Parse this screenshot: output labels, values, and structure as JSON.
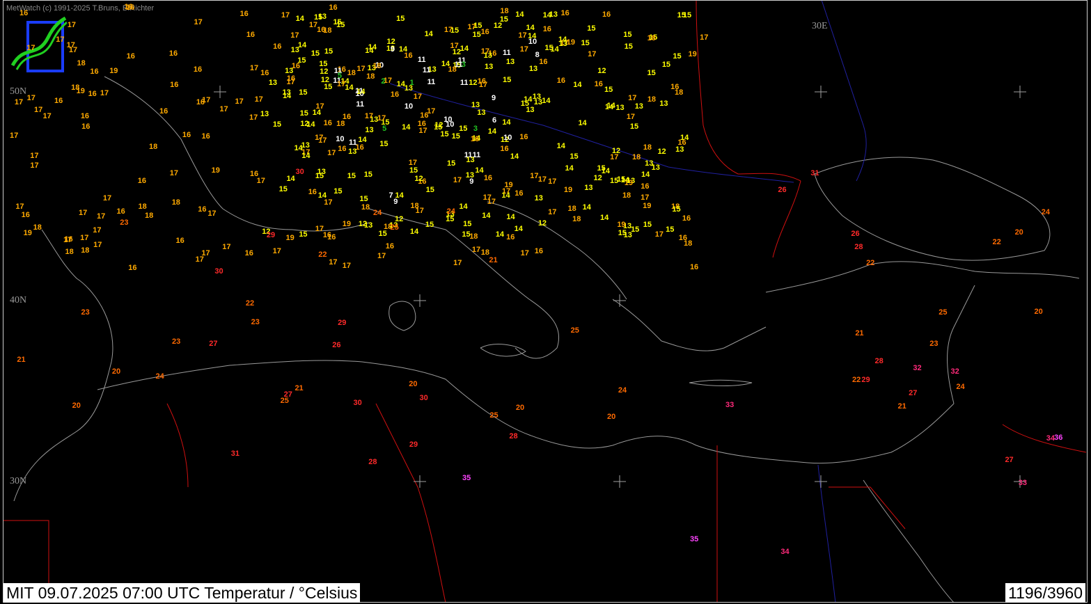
{
  "header": {
    "copyright": "MetWatch  (c) 1991-2025 T.Bruns, B.Richter"
  },
  "grid_labels": {
    "lon_30e": "30E",
    "lat_50n": "50N",
    "lat_40n": "40N",
    "lat_30n": "30N"
  },
  "footer": {
    "caption": "MIT 09.07.2025 07:00 UTC    Temperatur / °Celsius",
    "count": "1196/3960"
  },
  "legend_colors": {
    "le5": "#22c422",
    "6-11": "#ffffff",
    "12-15": "#ffff00",
    "16-19": "#ffaa00",
    "20-25": "#ff6a00",
    "26-31": "#ff2a2a",
    "32-34": "#ff2a7a",
    "35+": "#ff44ff"
  },
  "map_data": {
    "type": "station_temperature_map",
    "unit": "°C",
    "temperatures": [
      [
        "14",
        "16",
        "17",
        "16",
        "16",
        "17",
        "17",
        "17",
        "14",
        "14",
        "15",
        "15",
        "14",
        "15",
        "17",
        "16",
        "16",
        "15",
        "16",
        "16",
        "17",
        "18",
        "16",
        "16",
        "15",
        "17",
        "15",
        "18",
        "17",
        "16",
        "18",
        "17",
        "17",
        "16",
        "16",
        "15",
        "16",
        "15",
        "17",
        "17",
        "15",
        "17",
        "16",
        "17",
        "17",
        "17",
        "16",
        "15",
        "16",
        "17",
        "17",
        "15",
        "17",
        "17",
        "18",
        "15",
        "15",
        "14",
        "18",
        "15",
        "15",
        "15",
        "16",
        "16",
        "17",
        "16",
        "17",
        "17",
        "16",
        "17",
        "17",
        "16",
        "15",
        "16",
        "17",
        "17",
        "14",
        "17",
        "17",
        "16",
        "17",
        "17",
        "16",
        "16",
        "17",
        "17",
        "14",
        "14",
        "14",
        "13",
        "15",
        "14",
        "14",
        "13",
        "13",
        "14",
        "14",
        "15",
        "15",
        "17",
        "18",
        "15",
        "16",
        "17",
        "16",
        "18",
        "17",
        "17",
        "17",
        "17",
        "18",
        "17",
        "18",
        "15",
        "16",
        "14",
        "17",
        "15",
        "16",
        "17",
        "15",
        "16",
        "17",
        "17",
        "16",
        "17",
        "15",
        "15",
        "14",
        "15",
        "17",
        "14",
        "17",
        "14",
        "12",
        "14",
        "15",
        "13",
        "13",
        "13",
        "12",
        "11",
        "15",
        "14",
        "14",
        "14",
        "17",
        "16",
        "16",
        "16",
        "17",
        "13",
        "13",
        "14",
        "12",
        "12",
        "14",
        "12",
        "13",
        "13",
        "16",
        "15",
        "17",
        "16",
        "14",
        "18",
        "15",
        "16",
        "16",
        "13",
        "13",
        "14",
        "13",
        "14",
        "13",
        "13",
        "11",
        "11",
        "11",
        "10",
        "13",
        "16",
        "17",
        "15",
        "17",
        "15",
        "16",
        "16",
        "14",
        "15",
        "13",
        "12",
        "11",
        "12",
        "13",
        "14",
        "14",
        "14",
        "15",
        "15",
        "16",
        "15",
        "17",
        "13",
        "14",
        "15",
        "15",
        "16",
        "16",
        "16",
        "16",
        "15",
        "17",
        "13",
        "13",
        "15",
        "15",
        "17",
        "16",
        "15",
        "14",
        "13",
        "12",
        "13",
        "13",
        "15",
        "13",
        "15",
        "13",
        "14",
        "14",
        "11",
        "9",
        "16",
        "14",
        "11",
        "13",
        "12",
        "17",
        "14",
        "16",
        "19",
        "18",
        "17",
        "18",
        "17",
        "18",
        "16",
        "17",
        "15",
        "13",
        "12",
        "10",
        "14",
        "15",
        "16",
        "15",
        "14",
        "15",
        "15",
        "14",
        "14",
        "15",
        "17",
        "18",
        "16",
        "16",
        "14",
        "15",
        "16",
        "16",
        "16",
        "13",
        "13",
        "14",
        "14",
        "13",
        "12",
        "17",
        "18",
        "16",
        "17",
        "17",
        "18",
        "16",
        "17",
        "18",
        "17",
        "19",
        "16",
        "15",
        "14",
        "16",
        "17",
        "16",
        "17",
        "18",
        "19",
        "17",
        "18",
        "16",
        "16",
        "17",
        "14",
        "13",
        "13",
        "11",
        "13",
        "10",
        "9",
        "12",
        "15",
        "16",
        "14",
        "12",
        "10",
        "9",
        "10",
        "8",
        "11",
        "11",
        "14",
        "15",
        "16",
        "17",
        "18",
        "19",
        "20",
        "17",
        "17",
        "18",
        "18",
        "17",
        "17",
        "17",
        "13",
        "12",
        "11",
        "12",
        "13",
        "15",
        "14",
        "16",
        "16",
        "16",
        "17",
        "13",
        "13",
        "11",
        "12",
        "13",
        "15",
        "17",
        "18",
        "19",
        "15",
        "16",
        "17",
        "18",
        "19",
        "19",
        "10",
        "9",
        "6",
        "5",
        "3",
        "2",
        "1",
        "3",
        "5",
        "7",
        "11",
        "13",
        "15",
        "17",
        "18",
        "19",
        "20",
        "17",
        "18",
        "18",
        "17",
        "14",
        "14",
        "14",
        "15",
        "15",
        "14",
        "13",
        "13",
        "12",
        "11",
        "10",
        "10",
        "12",
        "14",
        "14",
        "15",
        "17",
        "18",
        "19",
        "20",
        "21",
        "22",
        "23",
        "24",
        "24",
        "25",
        "19",
        "20",
        "21",
        "22",
        "23",
        "24",
        "25",
        "26",
        "27",
        "28",
        "28",
        "29",
        "29",
        "29",
        "30",
        "31",
        "32",
        "33",
        "34",
        "34",
        "35",
        "35",
        "36",
        "33",
        "32",
        "31",
        "30",
        "30",
        "30",
        "29",
        "28",
        "28",
        "27",
        "27",
        "27",
        "26",
        "26",
        "25",
        "25",
        "25",
        "24",
        "24",
        "24",
        "23",
        "23",
        "23",
        "22",
        "22",
        "22",
        "21",
        "21",
        "21",
        "20",
        "20",
        "20",
        "19",
        "19",
        "19",
        "18",
        "18",
        "18",
        "17",
        "17",
        "17"
      ]
    ]
  }
}
